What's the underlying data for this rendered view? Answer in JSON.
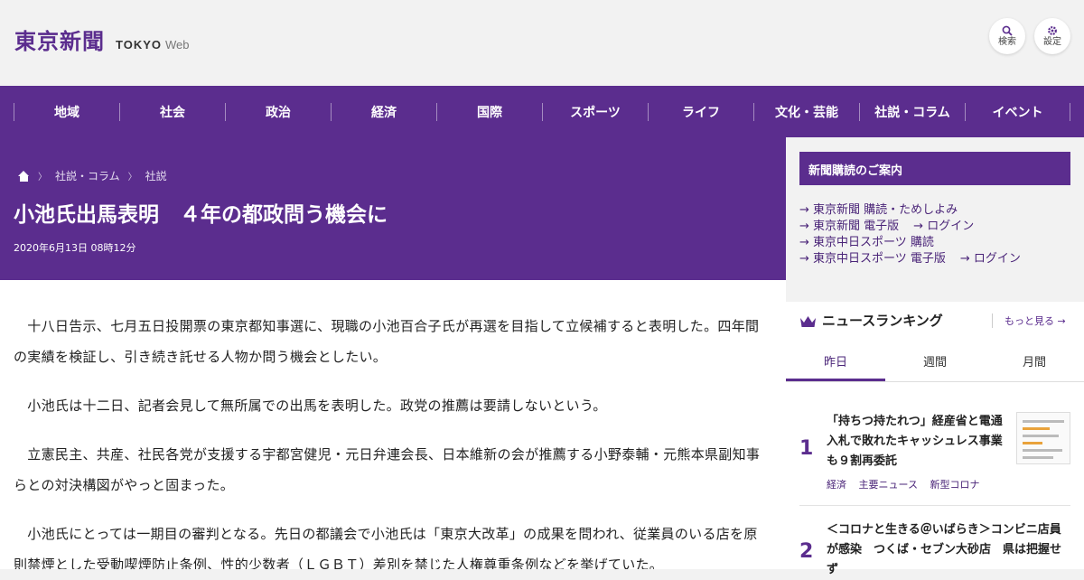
{
  "header": {
    "logo_kanji": "東京新聞",
    "logo_tokyo": "TOKYO",
    "logo_web": "Web",
    "search_label": "検索",
    "settings_label": "設定"
  },
  "nav": [
    "地域",
    "社会",
    "政治",
    "経済",
    "国際",
    "スポーツ",
    "ライフ",
    "文化・芸能",
    "社説・コラム",
    "イベント"
  ],
  "breadcrumb": [
    "社説・コラム",
    "社説"
  ],
  "article": {
    "title": "小池氏出馬表明　４年の都政問う機会に",
    "date": "2020年6月13日 08時12分",
    "paragraphs": [
      "　十八日告示、七月五日投開票の東京都知事選に、現職の小池百合子氏が再選を目指して立候補すると表明した。四年間の実績を検証し、引き続き託せる人物か問う機会としたい。",
      "　小池氏は十二日、記者会見して無所属での出馬を表明した。政党の推薦は要請しないという。",
      "　立憲民主、共産、社民各党が支援する宇都宮健児・元日弁連会長、日本維新の会が推薦する小野泰輔・元熊本県副知事らとの対決構図がやっと固まった。",
      "　小池氏にとっては一期目の審判となる。先日の都議会で小池氏は「東京大改革」の成果を問われ、従業員のいる店を原則禁煙とした受動喫煙防止条例、性的少数者（ＬＧＢＴ）差別を禁じた人権尊重条例などを挙げていた。"
    ]
  },
  "sidebar": {
    "promo_title": "新聞購読のご案内",
    "promo_rows": [
      [
        "→ 東京新聞 購読・ためしよみ"
      ],
      [
        "→ 東京新聞 電子版",
        "→ ログイン"
      ],
      [
        "→ 東京中日スポーツ 購読"
      ],
      [
        "→ 東京中日スポーツ 電子版",
        "→ ログイン"
      ]
    ],
    "ranking_title": "ニュースランキング",
    "more_label": "もっと見る",
    "tabs": [
      "昨日",
      "週間",
      "月間"
    ],
    "items": [
      {
        "rank": "1",
        "text": "「持ちつ持たれつ」経産省と電通　入札で敗れたキャッシュレス事業も９割再委託",
        "tags": [
          "経済",
          "主要ニュース",
          "新型コロナ"
        ]
      },
      {
        "rank": "2",
        "text": "＜コロナと生きる＠いばらき＞コンビニ店員が感染　つくば・セブン大砂店　県は把握せず",
        "tags": []
      }
    ]
  },
  "colors": {
    "brand": "#5b2d8e"
  }
}
